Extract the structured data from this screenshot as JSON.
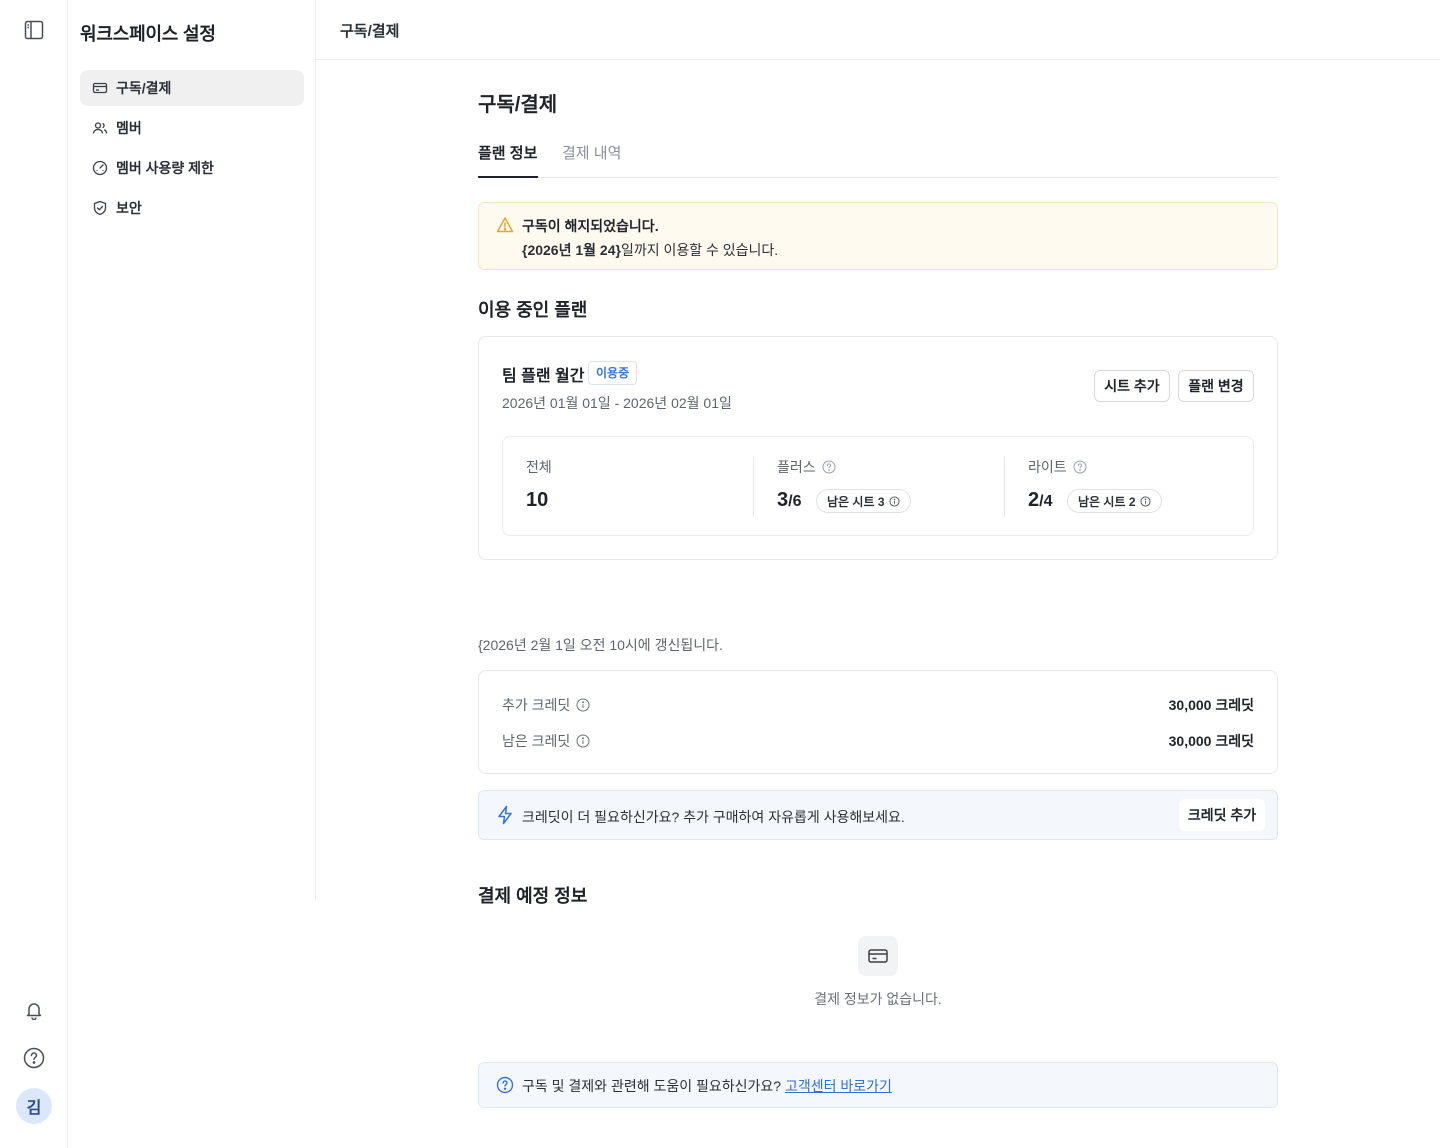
{
  "rail": {
    "avatar_initial": "김",
    "icons": [
      "sidebar-toggle-icon",
      "bell-icon",
      "help-icon"
    ]
  },
  "sidebar": {
    "title": "워크스페이스 설정",
    "items": [
      {
        "label": "구독/결제",
        "icon": "credit-card-icon",
        "active": true
      },
      {
        "label": "멤버",
        "icon": "members-icon",
        "active": false
      },
      {
        "label": "멤버 사용량 제한",
        "icon": "usage-gauge-icon",
        "active": false
      },
      {
        "label": "보안",
        "icon": "shield-icon",
        "active": false
      }
    ]
  },
  "header": {
    "breadcrumb": "구독/결제"
  },
  "main": {
    "title": "구독/결제",
    "tabs": [
      {
        "label": "플랜 정보",
        "active": true
      },
      {
        "label": "결제 내역",
        "active": false
      }
    ],
    "alert": {
      "title": "구독이 해지되었습니다.",
      "date": "{2026년 1월 24}",
      "suffix": "일까지 이용할 수 있습니다.",
      "icon": "warning-icon",
      "color": "#e0a82e"
    },
    "current_plan": {
      "section_title": "이용 중인 플랜",
      "name": "팀 플랜 월간",
      "badge": "이용중",
      "period": "2026년 01월 01일 - 2026년 02월 01일",
      "add_seat_label": "시트 추가",
      "change_plan_label": "플랜 변경",
      "stats": {
        "total": {
          "label": "전체",
          "value": "10"
        },
        "plus": {
          "label": "플러스",
          "used": "3",
          "total": "/6",
          "remaining": "남은 시트 3"
        },
        "lite": {
          "label": "라이트",
          "used": "2",
          "total": "/4",
          "remaining": "남은 시트 2"
        }
      }
    },
    "renewal_text": "{2026년 2월 1일 오전 10시에 갱신됩니다.",
    "credits": {
      "rows": [
        {
          "label": "추가 크레딧",
          "value": "30,000 크레딧"
        },
        {
          "label": "남은 크레딧",
          "value": "30,000 크레딧"
        }
      ]
    },
    "promo": {
      "text": "크레딧이 더 필요하신가요? 추가 구매하여 자유롭게 사용해보세요.",
      "button_label": "크레딧 추가",
      "icon": "lightning-icon"
    },
    "billing": {
      "section_title": "결제 예정 정보",
      "empty_text": "결제 정보가 없습니다.",
      "icon": "credit-card-icon"
    },
    "help": {
      "text": "구독 및 결제와 관련해 도움이 필요하신가요? ",
      "link_label": "고객센터 바로가기",
      "icon": "help-icon"
    },
    "colors": {
      "accent": "#3a72d8",
      "link": "#2f6fd6",
      "warning_bg": "#fffaf0",
      "info_bg": "#f4f8fd"
    }
  }
}
